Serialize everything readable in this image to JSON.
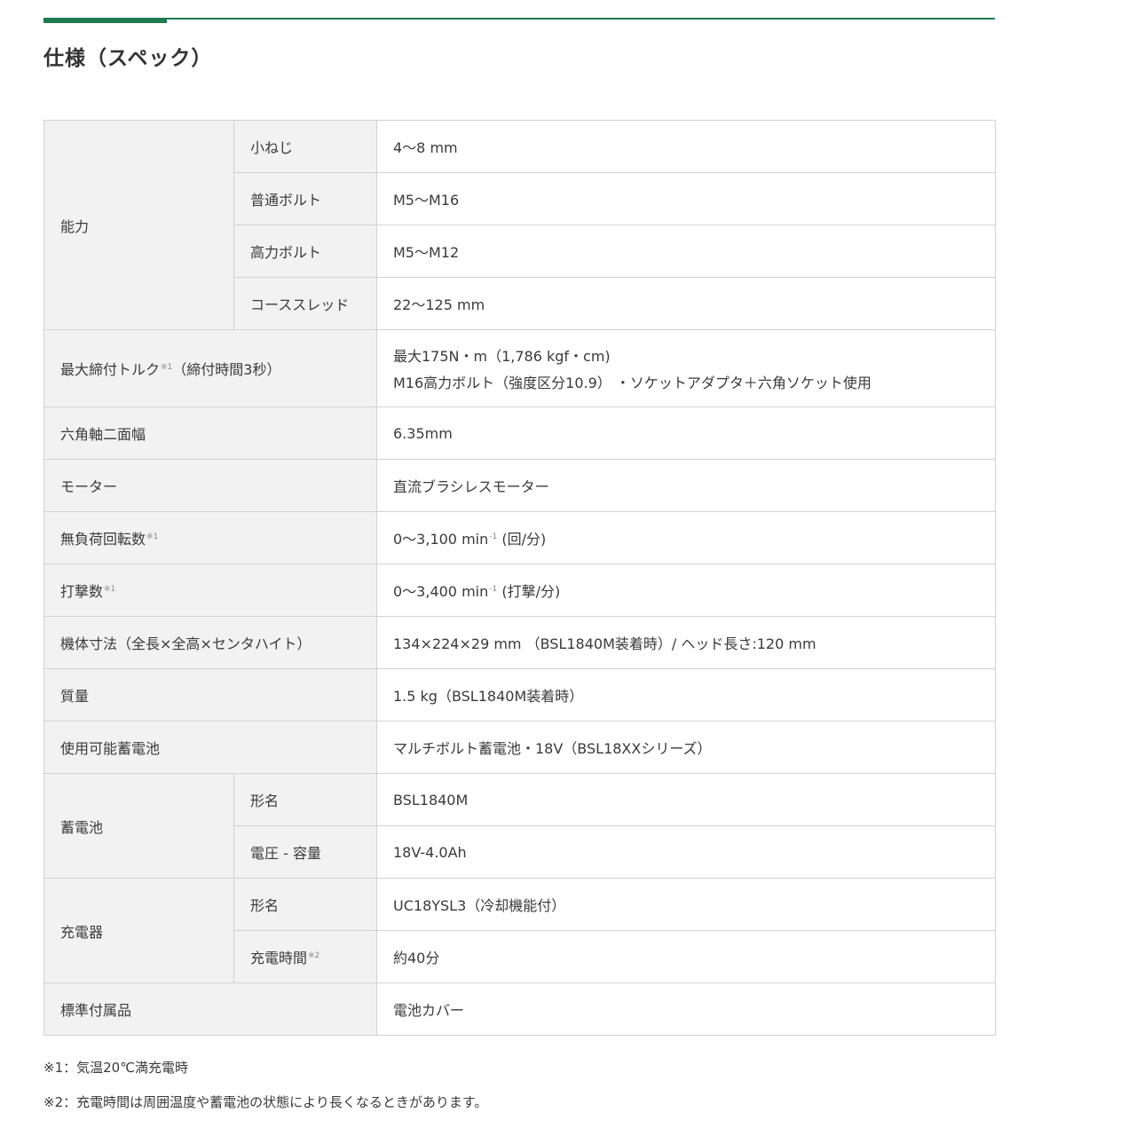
{
  "title": "仕様（スペック）",
  "rows": {
    "capacity": {
      "label": "能力",
      "small_screw": {
        "label": "小ねじ",
        "value": "4～8 mm"
      },
      "normal_bolt": {
        "label": "普通ボルト",
        "value": "M5～M16"
      },
      "high_bolt": {
        "label": "高力ボルト",
        "value": "M5～M12"
      },
      "coarse_thread": {
        "label": "コーススレッド",
        "value": "22～125 mm"
      }
    },
    "max_torque": {
      "label": "最大締付トルク",
      "note_mark": "※1",
      "label_suffix": "（締付時間3秒）",
      "value_line1": "最大175N・m（1,786 kgf・cm)",
      "value_line2": "M16高力ボルト（強度区分10.9） ・ソケットアダプタ＋六角ソケット使用"
    },
    "hex_shank": {
      "label": "六角軸二面幅",
      "value": "6.35mm"
    },
    "motor": {
      "label": "モーター",
      "value": "直流ブラシレスモーター"
    },
    "no_load_speed": {
      "label": "無負荷回転数",
      "note_mark": "※1",
      "value": "0～3,100 min",
      "value_sup": "-1",
      "value_suffix": " (回/分)"
    },
    "impact_rate": {
      "label": "打撃数",
      "note_mark": "※1",
      "value": "0～3,400 min",
      "value_sup": "-1",
      "value_suffix": " (打撃/分)"
    },
    "dimensions": {
      "label": "機体寸法（全長×全高×センタハイト）",
      "value": "134×224×29 mm （BSL1840M装着時）/ ヘッド長さ:120 mm"
    },
    "weight": {
      "label": "質量",
      "value": "1.5 kg（BSL1840M装着時）"
    },
    "usable_battery": {
      "label": "使用可能蓄電池",
      "value": "マルチボルト蓄電池・18V（BSL18XXシリーズ）"
    },
    "battery": {
      "label": "蓄電池",
      "model": {
        "label": "形名",
        "value": "BSL1840M"
      },
      "voltage_capacity": {
        "label": "電圧 - 容量",
        "value": "18V-4.0Ah"
      }
    },
    "charger": {
      "label": "充電器",
      "model": {
        "label": "形名",
        "value": "UC18YSL3（冷却機能付）"
      },
      "charge_time": {
        "label": "充電時間",
        "note_mark": "※2",
        "value": "約40分"
      }
    },
    "accessories": {
      "label": "標準付属品",
      "value": "電池カバー"
    }
  },
  "notes": [
    "※1：気温20℃満充電時",
    "※2：充電時間は周囲温度や蓄電池の状態により長くなるときがあります。"
  ]
}
